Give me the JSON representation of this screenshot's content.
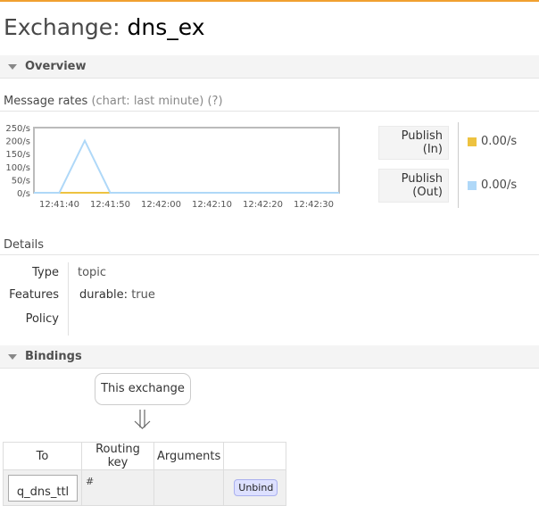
{
  "page": {
    "title_prefix": "Exchange: ",
    "exchange_name": "dns_ex"
  },
  "overview": {
    "section_label": "Overview",
    "message_rates_label": "Message rates",
    "chart_note": "(chart: last minute)",
    "help_link": "(?)"
  },
  "legend": [
    {
      "label_line1": "Publish",
      "label_line2": "(In)",
      "value": "0.00/s",
      "color": "#edc240"
    },
    {
      "label_line1": "Publish",
      "label_line2": "(Out)",
      "value": "0.00/s",
      "color": "#afd8f8"
    }
  ],
  "chart_data": {
    "type": "line",
    "y_ticks": [
      "250/s",
      "200/s",
      "150/s",
      "100/s",
      "50/s",
      "0/s"
    ],
    "x_ticks": [
      "12:41:40",
      "12:41:50",
      "12:42:00",
      "12:42:10",
      "12:42:20",
      "12:42:30"
    ],
    "ylim": [
      0,
      250
    ],
    "xlim": [
      "12:41:35",
      "12:42:35"
    ],
    "series": [
      {
        "name": "Publish (In)",
        "color": "#edc240",
        "points": [
          [
            "12:41:35",
            0
          ],
          [
            "12:42:35",
            0
          ]
        ]
      },
      {
        "name": "Publish (Out)",
        "color": "#afd8f8",
        "points": [
          [
            "12:41:35",
            0
          ],
          [
            "12:41:40",
            0
          ],
          [
            "12:41:45",
            200
          ],
          [
            "12:41:50",
            0
          ],
          [
            "12:42:35",
            0
          ]
        ]
      }
    ]
  },
  "details": {
    "heading": "Details",
    "type_key": "Type",
    "type_value": "topic",
    "features_key": "Features",
    "durable_key": "durable:",
    "durable_value": "true",
    "policy_key": "Policy"
  },
  "bindings": {
    "section_label": "Bindings",
    "this_exchange": "This exchange",
    "columns": [
      "To",
      "Routing key",
      "Arguments",
      ""
    ],
    "rows": [
      {
        "to": "q_dns_ttl",
        "routing_key": "#",
        "arguments": "",
        "action": "Unbind"
      }
    ]
  }
}
